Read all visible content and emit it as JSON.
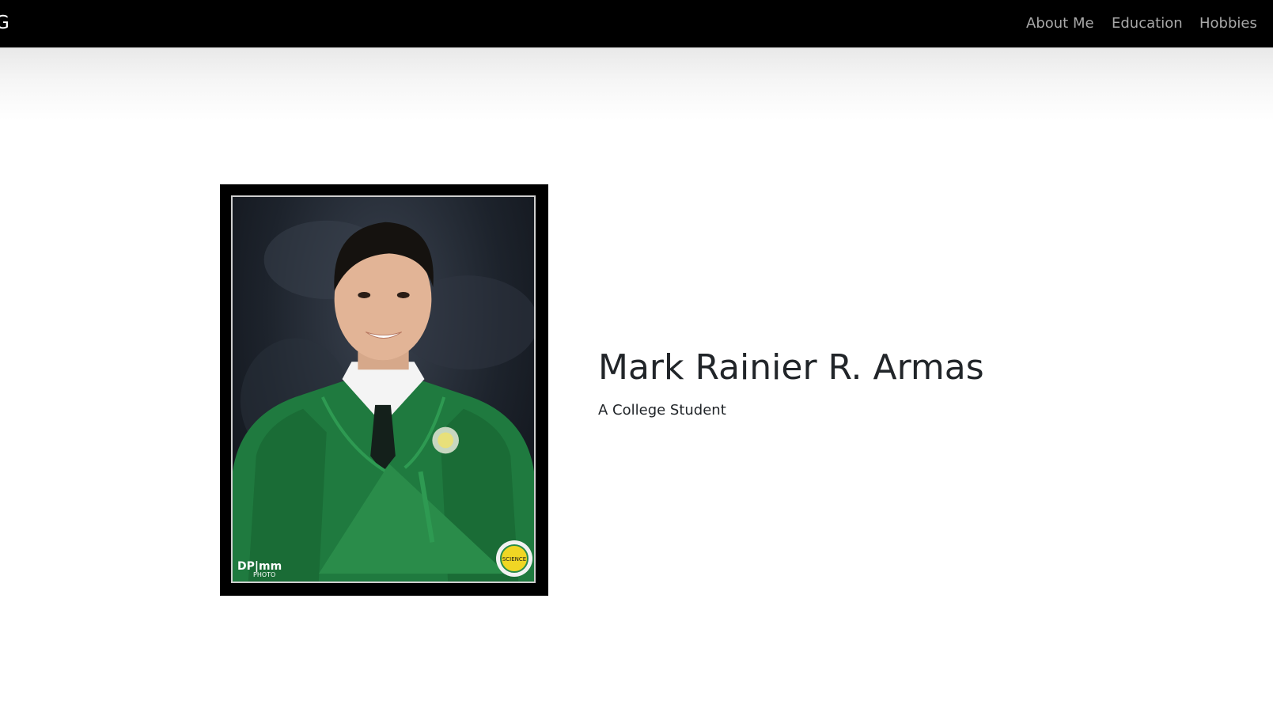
{
  "navbar": {
    "brand": "G",
    "links": [
      {
        "label": "About Me"
      },
      {
        "label": "Education"
      },
      {
        "label": "Hobbies"
      }
    ],
    "colors": {
      "background": "#000000",
      "link": "#a9a9a9",
      "brand": "#ffffff"
    }
  },
  "hero": {
    "name": "Mark Rainier R. Armas",
    "subtitle": "A College Student",
    "photo": {
      "icon": "graduation-portrait",
      "logo_text": "DP|mm",
      "logo_subtext": "PHOTO",
      "seal_text": "SCIENCE"
    }
  }
}
